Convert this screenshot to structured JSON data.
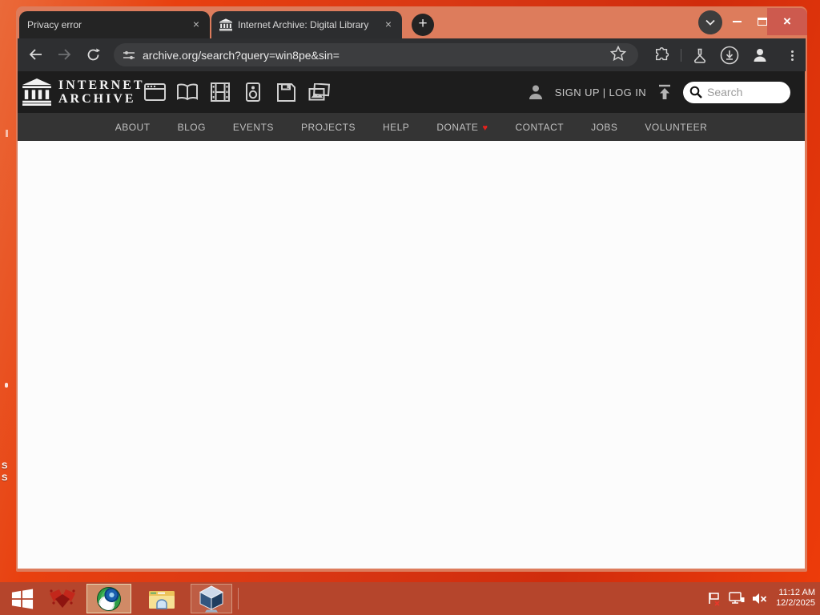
{
  "window": {
    "tabs": [
      {
        "title": "Privacy error"
      },
      {
        "title": "Internet Archive: Digital Library"
      }
    ],
    "new_tab_label": "+",
    "close_glyph": "×",
    "tab_close_glyph": "×"
  },
  "toolbar": {
    "url": "archive.org/search?query=win8pe&sin="
  },
  "site": {
    "logo_line1": "INTERNET",
    "logo_line2": "ARCHIVE",
    "signup_label": "SIGN UP",
    "account_divider": "|",
    "login_label": "LOG IN",
    "search_placeholder": "Search",
    "nav": {
      "about": "ABOUT",
      "blog": "BLOG",
      "events": "EVENTS",
      "projects": "PROJECTS",
      "help": "HELP",
      "donate": "DONATE",
      "contact": "CONTACT",
      "jobs": "JOBS",
      "volunteer": "VOLUNTEER"
    },
    "donate_heart": "♥"
  },
  "taskbar": {
    "time": "11:12 AM",
    "date": "12/2/2025"
  },
  "desktop": {
    "label_fragment_1": "S",
    "label_fragment_2": "S"
  },
  "colors": {
    "desktop_orange": "#e8400f",
    "frame_salmon": "#dd7c5c",
    "taskbar_red": "#b5452c",
    "close_button_red": "#cd5a4e",
    "header_black": "#1d1d1d",
    "nav_gray": "#343434",
    "heart_red": "#e6211c"
  }
}
